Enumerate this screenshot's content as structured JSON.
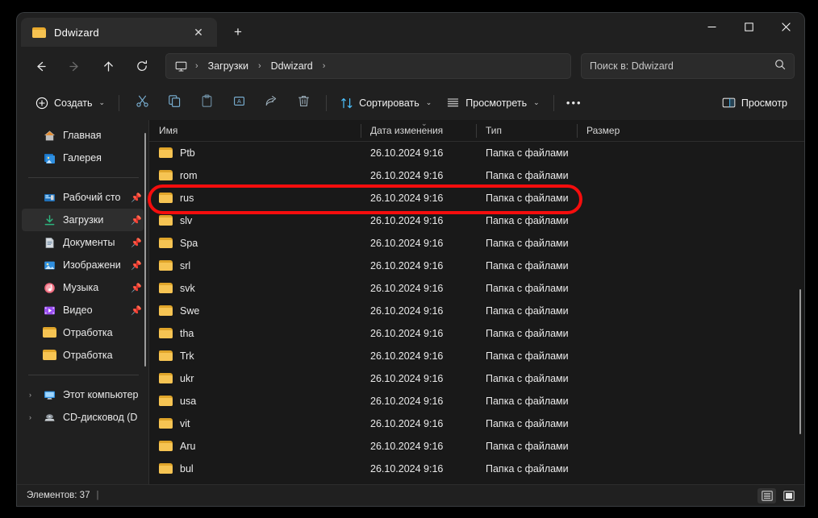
{
  "window": {
    "tab_title": "Ddwizard",
    "tab_close_label": "✕",
    "new_tab_label": "+",
    "minimize_label": "minimize",
    "maximize_label": "maximize",
    "close_label": "close"
  },
  "nav": {
    "back_label": "Назад",
    "forward_label": "Вперёд",
    "up_label": "Вверх",
    "refresh_label": "Обновить",
    "breadcrumbs": [
      "Загрузки",
      "Ddwizard"
    ],
    "separator": "›",
    "search_placeholder": "Поиск в: Ddwizard"
  },
  "toolbar": {
    "new_label": "Создать",
    "cut_label": "Вырезать",
    "copy_label": "Копировать",
    "paste_label": "Вставить",
    "rename_label": "Переименовать",
    "share_label": "Поделиться",
    "delete_label": "Удалить",
    "sort_label": "Сортировать",
    "view_label": "Просмотреть",
    "more_label": "•••",
    "details_pane_label": "Просмотр",
    "chevron": "⌄"
  },
  "sidebar": {
    "items": [
      {
        "label": "Главная",
        "icon": "home-icon",
        "pinned": false,
        "selected": false,
        "expandable": false
      },
      {
        "label": "Галерея",
        "icon": "gallery-icon",
        "pinned": false,
        "selected": false,
        "expandable": false
      },
      {
        "label": "Рабочий сто",
        "icon": "desktop-icon",
        "pinned": true,
        "selected": false,
        "expandable": false
      },
      {
        "label": "Загрузки",
        "icon": "downloads-icon",
        "pinned": true,
        "selected": true,
        "expandable": false
      },
      {
        "label": "Документы",
        "icon": "documents-icon",
        "pinned": true,
        "selected": false,
        "expandable": false
      },
      {
        "label": "Изображени",
        "icon": "pictures-icon",
        "pinned": true,
        "selected": false,
        "expandable": false
      },
      {
        "label": "Музыка",
        "icon": "music-icon",
        "pinned": true,
        "selected": false,
        "expandable": false
      },
      {
        "label": "Видео",
        "icon": "video-icon",
        "pinned": true,
        "selected": false,
        "expandable": false
      },
      {
        "label": "Отработка",
        "icon": "folder-icon",
        "pinned": false,
        "selected": false,
        "expandable": false
      },
      {
        "label": "Отработка",
        "icon": "folder-icon",
        "pinned": false,
        "selected": false,
        "expandable": false
      },
      {
        "label": "Этот компьютер",
        "icon": "this-pc-icon",
        "pinned": false,
        "selected": false,
        "expandable": true
      },
      {
        "label": "CD-дисковод (D",
        "icon": "cd-drive-icon",
        "pinned": false,
        "selected": false,
        "expandable": true
      }
    ],
    "expand_caret": "›"
  },
  "filelist": {
    "columns": [
      "Имя",
      "Дата изменения",
      "Тип",
      "Размер"
    ],
    "sort_indicator": "⌄",
    "rows": [
      {
        "name": "Ptb",
        "date": "26.10.2024 9:16",
        "type": "Папка с файлами",
        "size": "",
        "highlighted": false
      },
      {
        "name": "rom",
        "date": "26.10.2024 9:16",
        "type": "Папка с файлами",
        "size": "",
        "highlighted": false
      },
      {
        "name": "rus",
        "date": "26.10.2024 9:16",
        "type": "Папка с файлами",
        "size": "",
        "highlighted": true
      },
      {
        "name": "slv",
        "date": "26.10.2024 9:16",
        "type": "Папка с файлами",
        "size": "",
        "highlighted": false
      },
      {
        "name": "Spa",
        "date": "26.10.2024 9:16",
        "type": "Папка с файлами",
        "size": "",
        "highlighted": false
      },
      {
        "name": "srl",
        "date": "26.10.2024 9:16",
        "type": "Папка с файлами",
        "size": "",
        "highlighted": false
      },
      {
        "name": "svk",
        "date": "26.10.2024 9:16",
        "type": "Папка с файлами",
        "size": "",
        "highlighted": false
      },
      {
        "name": "Swe",
        "date": "26.10.2024 9:16",
        "type": "Папка с файлами",
        "size": "",
        "highlighted": false
      },
      {
        "name": "tha",
        "date": "26.10.2024 9:16",
        "type": "Папка с файлами",
        "size": "",
        "highlighted": false
      },
      {
        "name": "Trk",
        "date": "26.10.2024 9:16",
        "type": "Папка с файлами",
        "size": "",
        "highlighted": false
      },
      {
        "name": "ukr",
        "date": "26.10.2024 9:16",
        "type": "Папка с файлами",
        "size": "",
        "highlighted": false
      },
      {
        "name": "usa",
        "date": "26.10.2024 9:16",
        "type": "Папка с файлами",
        "size": "",
        "highlighted": false
      },
      {
        "name": "vit",
        "date": "26.10.2024 9:16",
        "type": "Папка с файлами",
        "size": "",
        "highlighted": false
      },
      {
        "name": "Aru",
        "date": "26.10.2024 9:16",
        "type": "Папка с файлами",
        "size": "",
        "highlighted": false
      },
      {
        "name": "bul",
        "date": "26.10.2024 9:16",
        "type": "Папка с файлами",
        "size": "",
        "highlighted": false
      }
    ]
  },
  "statusbar": {
    "items_count_text": "Элементов: 37",
    "divider": "|",
    "details_view_label": "Таблица",
    "tiles_view_label": "Крупные значки"
  },
  "colors": {
    "annotation": "#f50d0d",
    "folder_front": "#f6c453",
    "folder_back": "#e0a52a",
    "accent": "#4cc2ff",
    "window_bg": "#202020",
    "list_bg": "#191919"
  }
}
